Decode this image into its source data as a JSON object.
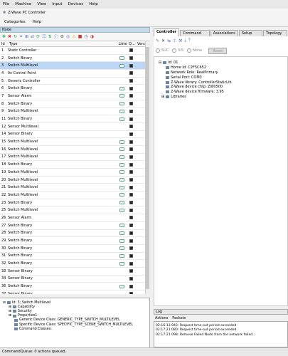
{
  "os_menu": [
    "File",
    "Machine",
    "View",
    "Input",
    "Devices",
    "Help"
  ],
  "window_title": "Z-Wave PC Controller",
  "app_menu": [
    "Categories",
    "Help"
  ],
  "node_panel": {
    "title": "Node",
    "columns": {
      "id": "Id",
      "type": "Type",
      "listening": "Liste",
      "queued": "Q...",
      "version": "Vers"
    }
  },
  "nodes": [
    {
      "id": "1",
      "type": "Static Controller",
      "listening": false
    },
    {
      "id": "2",
      "type": "Switch Binary",
      "listening": true
    },
    {
      "id": "3",
      "type": "Switch Multilevel",
      "listening": true
    },
    {
      "id": "4",
      "type": "Av Control Point",
      "listening": false
    },
    {
      "id": "5",
      "type": "Generic Controller",
      "listening": false
    },
    {
      "id": "6",
      "type": "Switch Binary",
      "listening": true
    },
    {
      "id": "7",
      "type": "Sensor Alarm",
      "listening": true
    },
    {
      "id": "8",
      "type": "Switch Binary",
      "listening": true
    },
    {
      "id": "9",
      "type": "Switch Multilevel",
      "listening": true
    },
    {
      "id": "11",
      "type": "Switch Binary",
      "listening": true
    },
    {
      "id": "12",
      "type": "Sensor Multilevel",
      "listening": false
    },
    {
      "id": "14",
      "type": "Sensor Binary",
      "listening": false
    },
    {
      "id": "15",
      "type": "Switch Multilevel",
      "listening": true
    },
    {
      "id": "16",
      "type": "Switch Multilevel",
      "listening": true
    },
    {
      "id": "17",
      "type": "Switch Multilevel",
      "listening": true
    },
    {
      "id": "18",
      "type": "Switch Binary",
      "listening": true
    },
    {
      "id": "19",
      "type": "Switch Multilevel",
      "listening": true
    },
    {
      "id": "20",
      "type": "Switch Multilevel",
      "listening": true
    },
    {
      "id": "21",
      "type": "Switch Multilevel",
      "listening": true
    },
    {
      "id": "22",
      "type": "Switch Multilevel",
      "listening": true
    },
    {
      "id": "23",
      "type": "Switch Binary",
      "listening": true
    },
    {
      "id": "25",
      "type": "Switch Multilevel",
      "listening": true
    },
    {
      "id": "26",
      "type": "Sensor Alarm",
      "listening": false
    },
    {
      "id": "27",
      "type": "Switch Binary",
      "listening": true
    },
    {
      "id": "28",
      "type": "Switch Binary",
      "listening": true
    },
    {
      "id": "29",
      "type": "Switch Binary",
      "listening": true
    },
    {
      "id": "30",
      "type": "Switch Binary",
      "listening": true
    },
    {
      "id": "31",
      "type": "Switch Binary",
      "listening": true
    },
    {
      "id": "32",
      "type": "Switch Binary",
      "listening": true
    },
    {
      "id": "33",
      "type": "Sensor Binary",
      "listening": false
    },
    {
      "id": "34",
      "type": "Sensor Binary",
      "listening": false
    },
    {
      "id": "36",
      "type": "Switch Binary",
      "listening": true
    },
    {
      "id": "37",
      "type": "Sensor Binary",
      "listening": false
    }
  ],
  "selected_node_index": 2,
  "detail_tree": {
    "root": "Id: 3; Switch Multilevel",
    "items": [
      "Capability",
      "Security",
      "Properties1"
    ],
    "props": [
      "Generic Device Class: GENERIC_TYPE_SWITCH_MULTILEVEL",
      "Specific Device Class: SPECIFIC_TYPE_SCENE_SWITCH_MULTILEVEL",
      "Command Classes:"
    ]
  },
  "right_tabs": [
    "Controller",
    "Command Class",
    "Associations",
    "Setup Route",
    "Topology Ma"
  ],
  "radios": [
    "SUC",
    "SIS",
    "None"
  ],
  "reset_button": "Reset",
  "controller_tree": {
    "root": "Id: 01",
    "items": [
      "Home Id: C2F5C652",
      "Network Role: RealPrimary",
      "Serial Port: COM3",
      "Z-Wave library: ControllerStaticLib",
      "Z-Wave device chip: ZW0500",
      "Z-Wave device firmware:  3.95"
    ],
    "libraries": "Libraries"
  },
  "log": {
    "title": "Log",
    "tabs": [
      "Actions",
      "Packets"
    ],
    "lines": [
      "02:16:13.943: Request time-out period exceeded",
      "02:17:21.080: Request time-out period exceeded",
      "02:17:21.098: Remove Failed Node from the network failed..."
    ]
  },
  "status": "CommandQueue: 0 actions queued."
}
